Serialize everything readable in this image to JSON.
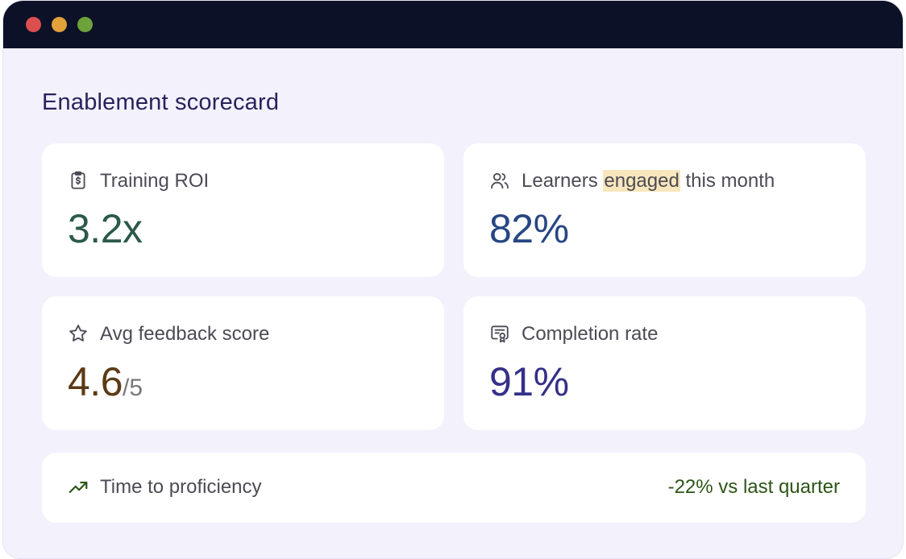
{
  "window": {
    "controls": [
      "close",
      "minimize",
      "maximize"
    ]
  },
  "page": {
    "title": "Enablement scorecard"
  },
  "cards": [
    {
      "icon": "clipboard-dollar-icon",
      "label": "Training ROI",
      "value": "3.2x",
      "value_color": "#2b5a48"
    },
    {
      "icon": "users-icon",
      "label_before": "Learners ",
      "label_highlight": "engaged",
      "label_after": " this month",
      "value": "82%",
      "value_color": "#274783"
    },
    {
      "icon": "star-icon",
      "label": "Avg feedback score",
      "value": "4.6",
      "value_suffix": "/5",
      "value_color": "#5c3a16"
    },
    {
      "icon": "certificate-icon",
      "label": "Completion rate",
      "value": "91%",
      "value_color": "#353088"
    }
  ],
  "proficiency": {
    "icon": "trending-up-icon",
    "label": "Time to proficiency",
    "delta": "-22% vs last quarter",
    "delta_color": "#2d5416"
  },
  "colors": {
    "titlebar": "#0c1127",
    "background": "#f3f1fc",
    "title": "#26235d",
    "highlight": "#f8e7bd"
  }
}
